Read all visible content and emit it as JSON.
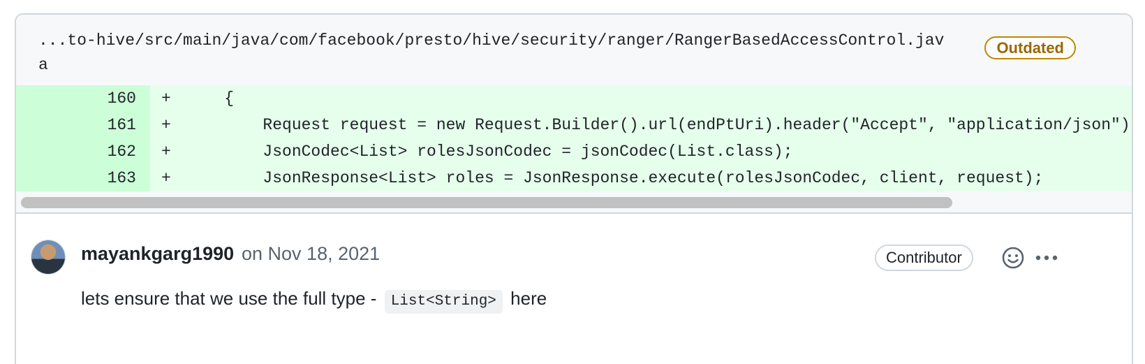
{
  "file": {
    "path": "...to-hive/src/main/java/com/facebook/presto/hive/security/ranger/RangerBasedAccessControl.java",
    "status_badge": "Outdated"
  },
  "diff": {
    "lines": [
      {
        "num": "160",
        "marker": "+",
        "code": "    {"
      },
      {
        "num": "161",
        "marker": "+",
        "code": "        Request request = new Request.Builder().url(endPtUri).header(\"Accept\", \"application/json\")"
      },
      {
        "num": "162",
        "marker": "+",
        "code": "        JsonCodec<List> rolesJsonCodec = jsonCodec(List.class);"
      },
      {
        "num": "163",
        "marker": "+",
        "code": "        JsonResponse<List> roles = JsonResponse.execute(rolesJsonCodec, client, request);"
      }
    ]
  },
  "comment": {
    "author": "mayankgarg1990",
    "date": "on Nov 18, 2021",
    "role_badge": "Contributor",
    "body_before": "lets ensure that we use the full type -",
    "body_code": "List<String>",
    "body_after": "here",
    "icons": [
      "smiley-icon",
      "kebab-icon"
    ]
  },
  "colors": {
    "added_line_bg": "#e6ffec",
    "added_num_bg": "#ccffd8",
    "outdated": "#9a6700"
  }
}
